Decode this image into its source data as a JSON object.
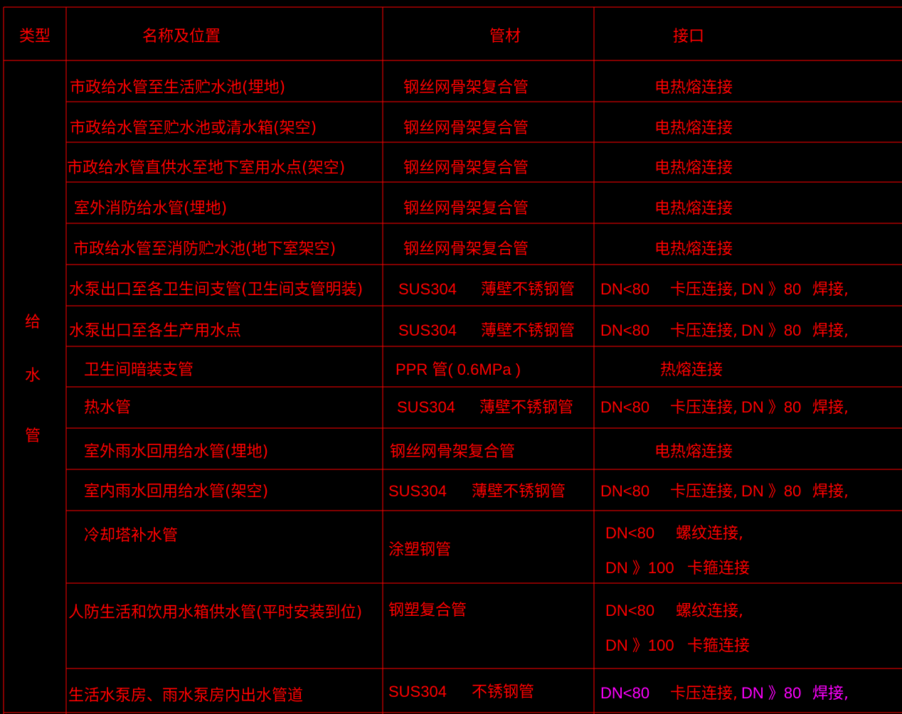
{
  "colors": {
    "background": "#000000",
    "grid": "#ff0000",
    "text": "#ff0000",
    "highlight": "#ff00ff"
  },
  "header": {
    "type": "类型",
    "name": "名称及位置",
    "material": "管材",
    "joint": "接口"
  },
  "category": {
    "chars": [
      "给",
      "水",
      "管"
    ]
  },
  "rows": [
    {
      "name": "市政给水管至生活贮水池(埋地)",
      "material": [
        "钢丝网骨架复合管"
      ],
      "joint": [
        "电热熔连接"
      ]
    },
    {
      "name": "市政给水管至贮水池或清水箱(架空)",
      "material": [
        "钢丝网骨架复合管"
      ],
      "joint": [
        "电热熔连接"
      ]
    },
    {
      "name": "市政给水管直供水至地下室用水点(架空)",
      "material": [
        "钢丝网骨架复合管"
      ],
      "joint": [
        "电热熔连接"
      ]
    },
    {
      "name": "室外消防给水管(埋地)",
      "material": [
        "钢丝网骨架复合管"
      ],
      "joint": [
        "电热熔连接"
      ]
    },
    {
      "name": "市政给水管至消防贮水池(地下室架空)",
      "material": [
        "钢丝网骨架复合管"
      ],
      "joint": [
        "电热熔连接"
      ]
    },
    {
      "name": "水泵出口至各卫生间支管(卫生间支管明装)",
      "material": [
        "SUS304",
        "薄壁不锈钢管"
      ],
      "joint": [
        "DN<80",
        "卡压连接,",
        "DN 》80",
        "焊接,"
      ]
    },
    {
      "name": "水泵出口至各生产用水点",
      "material": [
        "SUS304",
        "薄壁不锈钢管"
      ],
      "joint": [
        "DN<80",
        "卡压连接,",
        "DN 》80",
        "焊接,"
      ]
    },
    {
      "name": "卫生间暗装支管",
      "material": [
        "PPR 管( 0.6MPa )"
      ],
      "joint": [
        "热熔连接"
      ]
    },
    {
      "name": "热水管",
      "material": [
        "SUS304",
        "薄壁不锈钢管"
      ],
      "joint": [
        "DN<80",
        "卡压连接,",
        "DN 》80",
        "焊接,"
      ]
    },
    {
      "name": "室外雨水回用给水管(埋地)",
      "material": [
        "钢丝网骨架复合管"
      ],
      "joint": [
        "电热熔连接"
      ]
    },
    {
      "name": "室内雨水回用给水管(架空)",
      "material": [
        "SUS304",
        "薄壁不锈钢管"
      ],
      "joint": [
        "DN<80",
        "卡压连接,",
        "DN 》80",
        "焊接,"
      ]
    },
    {
      "name": "冷却塔补水管",
      "material": [
        "涂塑钢管"
      ],
      "joint": [
        "DN<80",
        "螺纹连接,",
        "DN 》100",
        "卡箍连接"
      ]
    },
    {
      "name": "人防生活和饮用水箱供水管(平时安装到位)",
      "material": [
        "钢塑复合管"
      ],
      "joint": [
        "DN<80",
        "螺纹连接,",
        "DN 》100",
        "卡箍连接"
      ]
    },
    {
      "name": "生活水泵房、雨水泵房内出水管道",
      "material": [
        "SUS304",
        "不锈钢管"
      ],
      "joint": [
        "DN<80",
        "卡压连接,",
        "DN 》80",
        "焊接,"
      ]
    }
  ]
}
